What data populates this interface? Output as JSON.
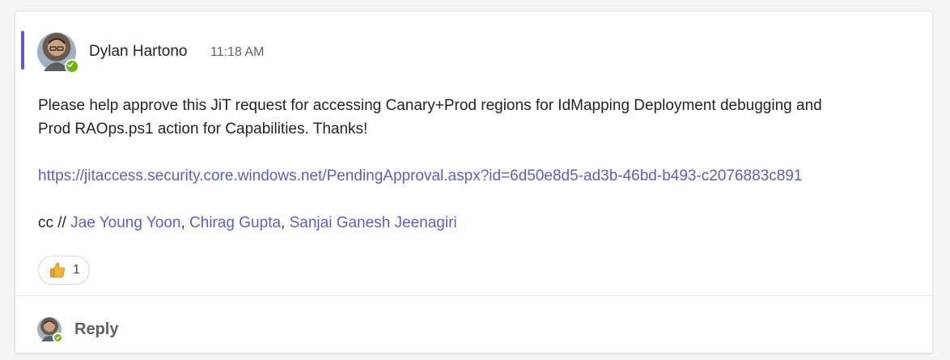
{
  "message": {
    "author": "Dylan Hartono",
    "time": "11:18 AM",
    "line1": "Please help approve this JiT request for accessing Canary+Prod regions for IdMapping Deployment debugging and",
    "line2": "Prod RAOps.ps1 action for Capabilities. Thanks!",
    "url": "https://jitaccess.security.core.windows.net/PendingApproval.aspx?id=6d50e8d5-ad3b-46bd-b493-c2076883c891",
    "cc_prefix": "cc // ",
    "mentions": [
      "Jae Young Yoon",
      "Chirag Gupta",
      "Sanjai Ganesh Jeenagiri"
    ],
    "separator": ", "
  },
  "reaction": {
    "icon": "thumbs-up-icon",
    "count": "1"
  },
  "reply": {
    "label": "Reply"
  },
  "colors": {
    "accent": "#5b5fc7",
    "presence": "#6bb700",
    "link": "#5b5fc7"
  }
}
